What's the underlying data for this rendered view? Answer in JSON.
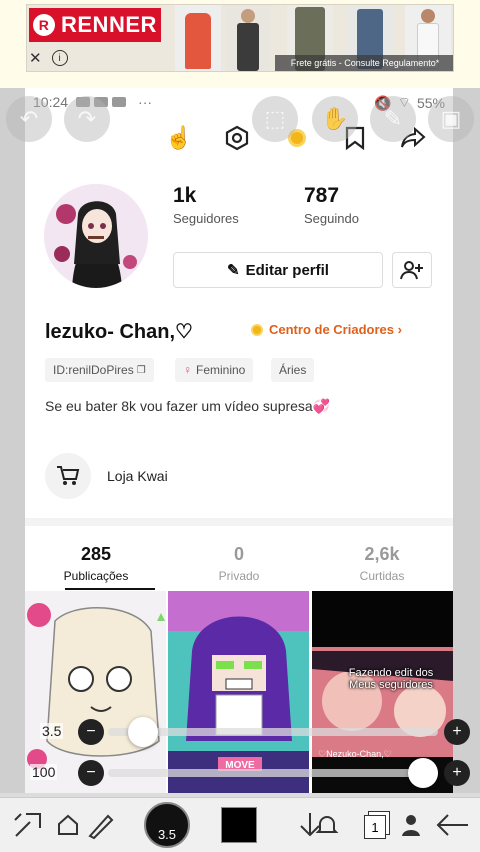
{
  "ad": {
    "brand": "RENNER",
    "footer": "Frete grátis - Consulte Regulamento*",
    "close_icon": "close-icon",
    "info_icon": "info-icon"
  },
  "statusbar": {
    "time": "10:24",
    "battery": "55%",
    "more": "···"
  },
  "profile": {
    "followers_count": "1k",
    "followers_label": "Seguidores",
    "following_count": "787",
    "following_label": "Seguindo",
    "edit_label": "Editar perfil",
    "username": "lezuko- Chan,♡",
    "creators_label": "Centro de Criadores ›",
    "tags": [
      "ID:renilDoPires",
      "Feminino",
      "Áries"
    ],
    "bio": "Se eu bater 8k vou fazer um vídeo supresa💞",
    "shop_label": "Loja Kwai"
  },
  "tabs": [
    {
      "count": "285",
      "label": "Publicações"
    },
    {
      "count": "0",
      "label": "Privado"
    },
    {
      "count": "2,6k",
      "label": "Curtidas"
    }
  ],
  "thumbnails": [
    {
      "caption": ""
    },
    {
      "caption": "MOVE"
    },
    {
      "caption": "Fazendo edit dos Meus seguidores",
      "footer": "♡Nezuko-Chan,♡"
    }
  ],
  "overlay": {
    "size_value": "3.5",
    "opacity_value": "100",
    "brush_size_badge": "3.5",
    "layer_count": "1"
  },
  "colors": {
    "brand_red": "#d8102a",
    "creator_orange": "#e0601a",
    "text": "#111111"
  }
}
